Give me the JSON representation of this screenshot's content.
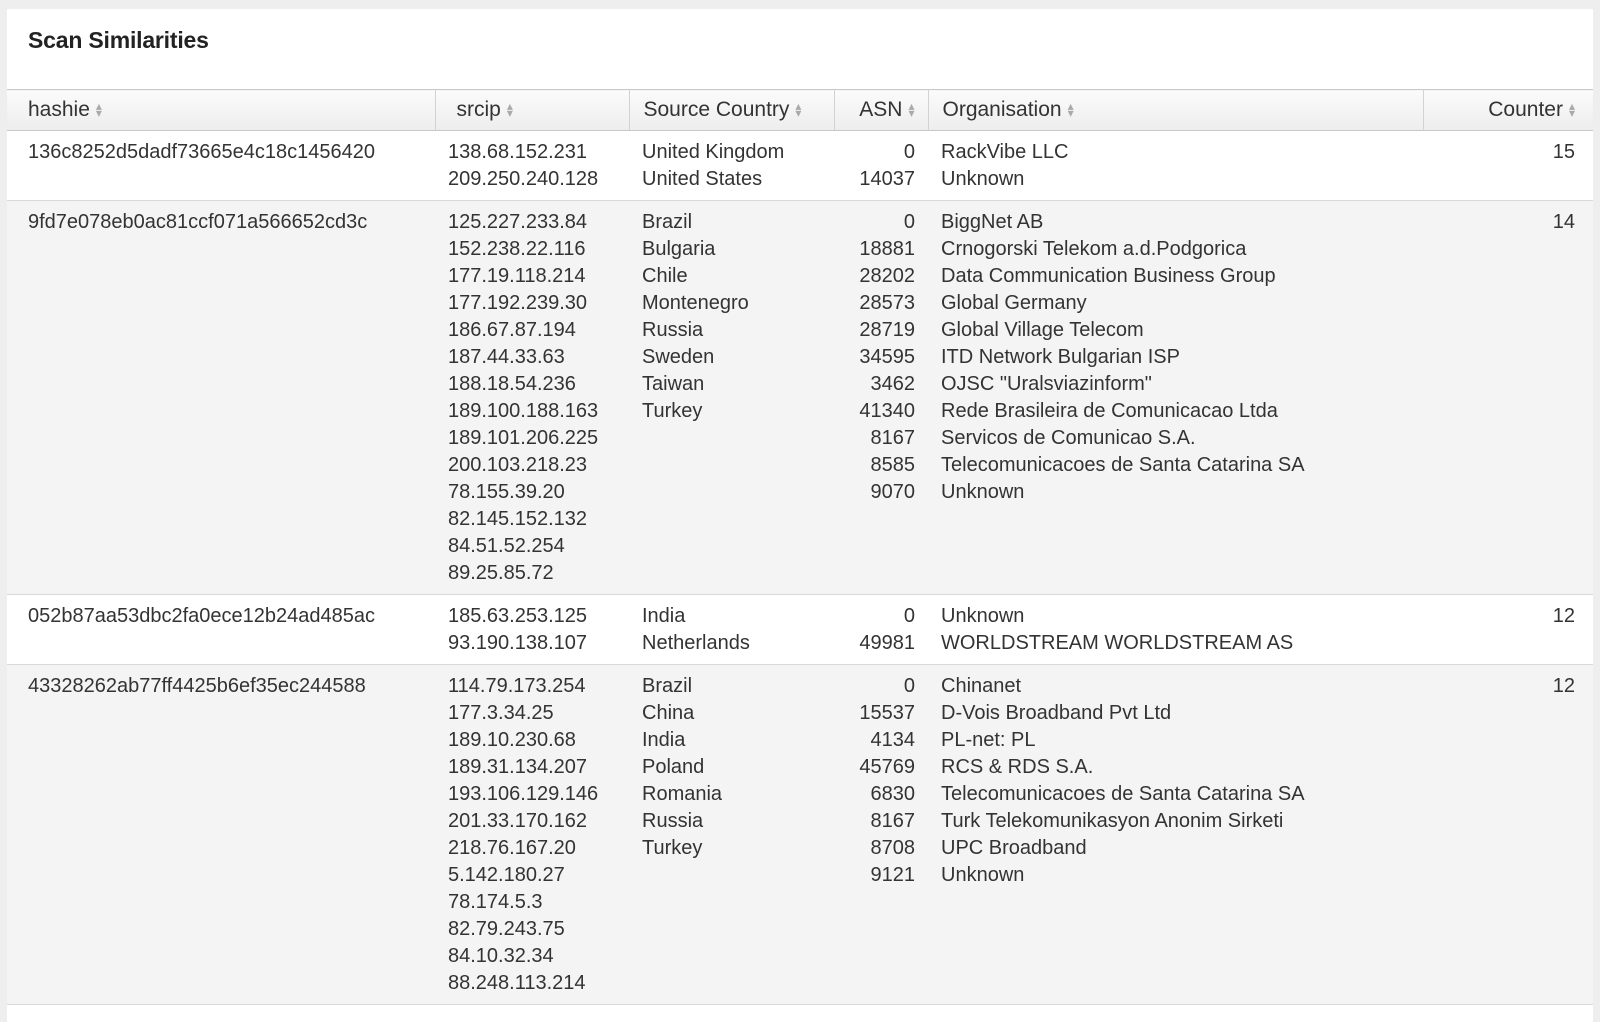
{
  "panel": {
    "title": "Scan Similarities"
  },
  "table": {
    "columns": [
      "hashie",
      "srcip",
      "Source Country",
      "ASN",
      "Organisation",
      "Counter"
    ],
    "rows": [
      {
        "hashie": "136c8252d5dadf73665e4c18c1456420",
        "srcip": [
          "138.68.152.231",
          "209.250.240.128"
        ],
        "country": [
          "United Kingdom",
          "United States"
        ],
        "asn": [
          "0",
          "14037"
        ],
        "org": [
          "RackVibe LLC",
          "Unknown"
        ],
        "counter": "15"
      },
      {
        "hashie": "9fd7e078eb0ac81ccf071a566652cd3c",
        "srcip": [
          "125.227.233.84",
          "152.238.22.116",
          "177.19.118.214",
          "177.192.239.30",
          "186.67.87.194",
          "187.44.33.63",
          "188.18.54.236",
          "189.100.188.163",
          "189.101.206.225",
          "200.103.218.23",
          "78.155.39.20",
          "82.145.152.132",
          "84.51.52.254",
          "89.25.85.72"
        ],
        "country": [
          "Brazil",
          "Bulgaria",
          "Chile",
          "Montenegro",
          "Russia",
          "Sweden",
          "Taiwan",
          "Turkey"
        ],
        "asn": [
          "0",
          "18881",
          "28202",
          "28573",
          "28719",
          "34595",
          "3462",
          "41340",
          "8167",
          "8585",
          "9070"
        ],
        "org": [
          "BiggNet AB",
          "Crnogorski Telekom a.d.Podgorica",
          "Data Communication Business Group",
          "Global Germany",
          "Global Village Telecom",
          "ITD Network Bulgarian ISP",
          "OJSC \"Uralsviazinform\"",
          "Rede Brasileira de Comunicacao Ltda",
          "Servicos de Comunicao S.A.",
          "Telecomunicacoes de Santa Catarina SA",
          "Unknown"
        ],
        "counter": "14"
      },
      {
        "hashie": "052b87aa53dbc2fa0ece12b24ad485ac",
        "srcip": [
          "185.63.253.125",
          "93.190.138.107"
        ],
        "country": [
          "India",
          "Netherlands"
        ],
        "asn": [
          "0",
          "49981"
        ],
        "org": [
          "Unknown",
          "WORLDSTREAM WORLDSTREAM AS"
        ],
        "counter": "12"
      },
      {
        "hashie": "43328262ab77ff4425b6ef35ec244588",
        "srcip": [
          "114.79.173.254",
          "177.3.34.25",
          "189.10.230.68",
          "189.31.134.207",
          "193.106.129.146",
          "201.33.170.162",
          "218.76.167.20",
          "5.142.180.27",
          "78.174.5.3",
          "82.79.243.75",
          "84.10.32.34",
          "88.248.113.214"
        ],
        "country": [
          "Brazil",
          "China",
          "India",
          "Poland",
          "Romania",
          "Russia",
          "Turkey"
        ],
        "asn": [
          "0",
          "15537",
          "4134",
          "45769",
          "6830",
          "8167",
          "8708",
          "9121"
        ],
        "org": [
          "Chinanet",
          "D-Vois Broadband Pvt Ltd",
          "PL-net: PL",
          "RCS & RDS S.A.",
          "Telecomunicacoes de Santa Catarina SA",
          "Turk Telekomunikasyon Anonim Sirketi",
          "UPC Broadband",
          "Unknown"
        ],
        "counter": "12"
      }
    ]
  }
}
